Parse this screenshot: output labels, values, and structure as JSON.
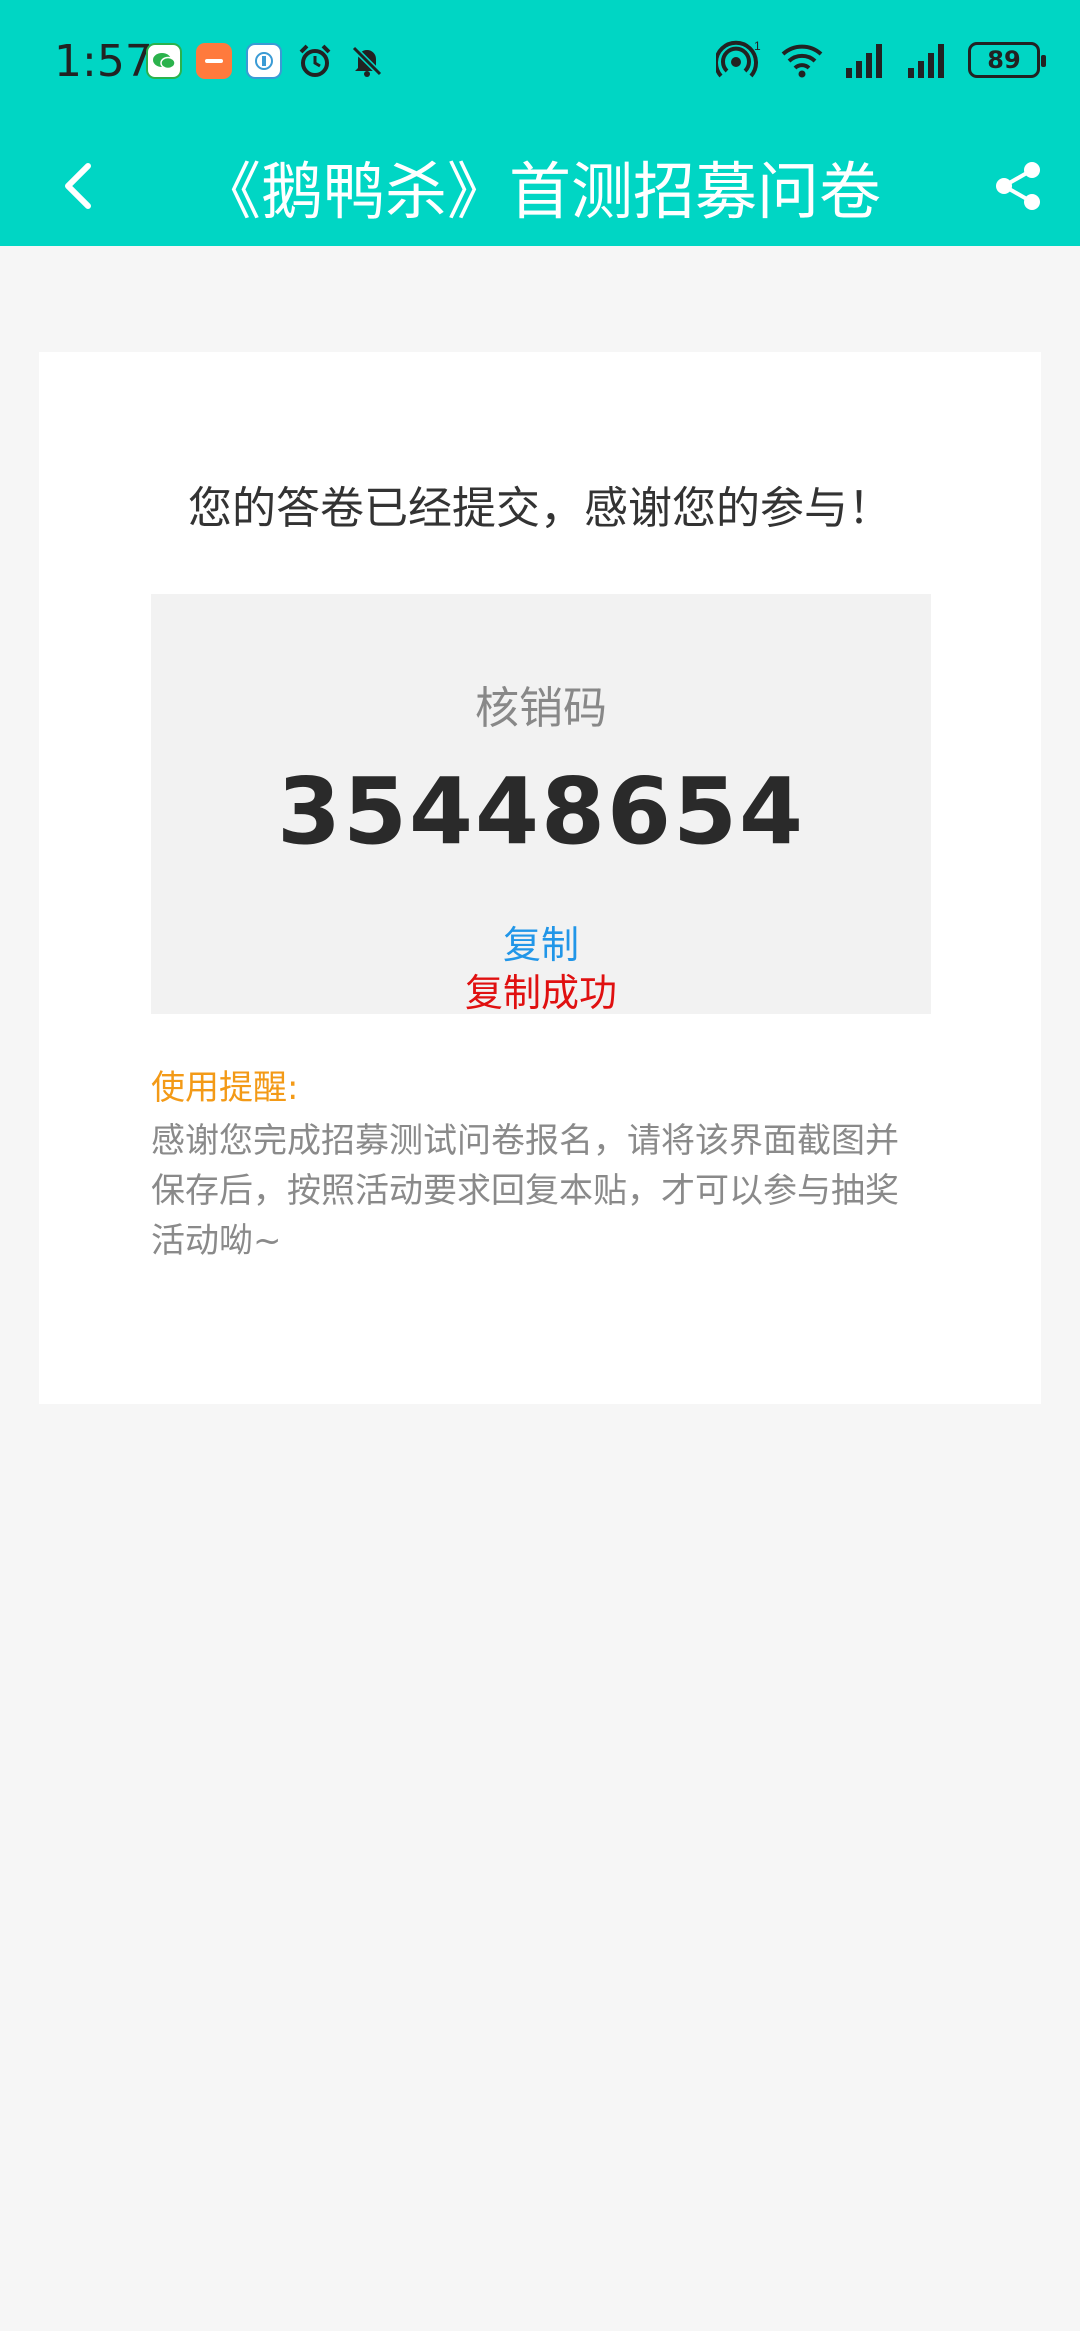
{
  "status_bar": {
    "time": "1:57",
    "battery": "89",
    "icons": [
      "wechat-icon",
      "orange-app-icon",
      "app-icon",
      "alarm-icon",
      "mute-icon",
      "hotspot-icon",
      "wifi-icon",
      "signal-icon",
      "signal-icon-2",
      "battery-icon"
    ]
  },
  "app_bar": {
    "title": "《鹅鸭杀》首测招募问卷",
    "back_icon": "chevron-left-icon",
    "share_icon": "share-icon",
    "color": "#00d6c4"
  },
  "card": {
    "thanks": "您的答卷已经提交，感谢您的参与！",
    "code_label": "核销码",
    "code_value": "35448654",
    "copy_label": "复制",
    "copy_success": "复制成功",
    "tip_title": "使用提醒:",
    "tip_body": "感谢您完成招募测试问卷报名，请将该界面截图并保存后，按照活动要求回复本贴，才可以参与抽奖活动呦~"
  }
}
